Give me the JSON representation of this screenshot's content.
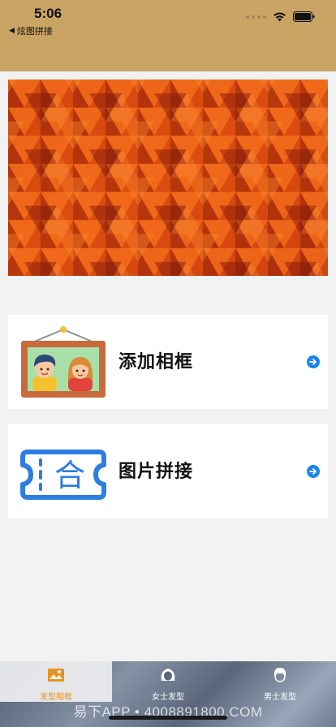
{
  "status": {
    "time": "5:06"
  },
  "nav": {
    "back_label": "炫图拼接"
  },
  "cards": [
    {
      "label": "添加相框",
      "icon": "photo-frame-icon"
    },
    {
      "label": "图片拼接",
      "icon": "ticket-merge-icon",
      "icon_text": "合"
    }
  ],
  "tabs": [
    {
      "label": "发型相框",
      "icon": "photo-icon",
      "active": true
    },
    {
      "label": "女士发型",
      "icon": "female-hair-icon",
      "active": false
    },
    {
      "label": "男士发型",
      "icon": "male-hair-icon",
      "active": false
    }
  ],
  "watermark": "易下APP • 4008891800.COM",
  "colors": {
    "header": "#c9a464",
    "accent": "#1a84f0",
    "tab_active": "#e89320"
  }
}
